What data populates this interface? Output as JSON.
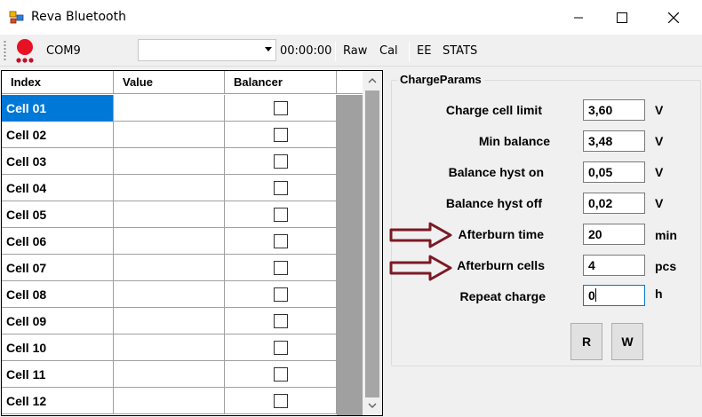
{
  "window": {
    "title": "Reva Bluetooth"
  },
  "toolbar": {
    "port": "COM9",
    "combo_value": "",
    "time": "00:00:00",
    "raw": "Raw",
    "cal": "Cal",
    "ee": "EE",
    "stats": "STATS"
  },
  "grid": {
    "columns": [
      "Index",
      "Value",
      "Balancer"
    ],
    "rows": [
      {
        "index": "Cell 01",
        "value": "",
        "balancer": false
      },
      {
        "index": "Cell 02",
        "value": "",
        "balancer": false
      },
      {
        "index": "Cell 03",
        "value": "",
        "balancer": false
      },
      {
        "index": "Cell 04",
        "value": "",
        "balancer": false
      },
      {
        "index": "Cell 05",
        "value": "",
        "balancer": false
      },
      {
        "index": "Cell 06",
        "value": "",
        "balancer": false
      },
      {
        "index": "Cell 07",
        "value": "",
        "balancer": false
      },
      {
        "index": "Cell 08",
        "value": "",
        "balancer": false
      },
      {
        "index": "Cell 09",
        "value": "",
        "balancer": false
      },
      {
        "index": "Cell 10",
        "value": "",
        "balancer": false
      },
      {
        "index": "Cell 11",
        "value": "",
        "balancer": false
      },
      {
        "index": "Cell 12",
        "value": "",
        "balancer": false
      }
    ]
  },
  "charge_params": {
    "title": "ChargeParams",
    "params": [
      {
        "label": "Charge cell limit",
        "value": "3,60",
        "unit": "V"
      },
      {
        "label": "Min balance",
        "value": "3,48",
        "unit": "V"
      },
      {
        "label": "Balance hyst on",
        "value": "0,05",
        "unit": "V"
      },
      {
        "label": "Balance hyst off",
        "value": "0,02",
        "unit": "V"
      },
      {
        "label": "Afterburn time",
        "value": "20",
        "unit": "min"
      },
      {
        "label": "Afterburn cells",
        "value": "4",
        "unit": "pcs"
      },
      {
        "label": "Repeat charge",
        "value": "0",
        "unit": "h"
      }
    ],
    "read_button": "R",
    "write_button": "W"
  },
  "colors": {
    "selection": "#0078d7",
    "arrow": "#7b1a24",
    "status_dot": "#e81123"
  }
}
